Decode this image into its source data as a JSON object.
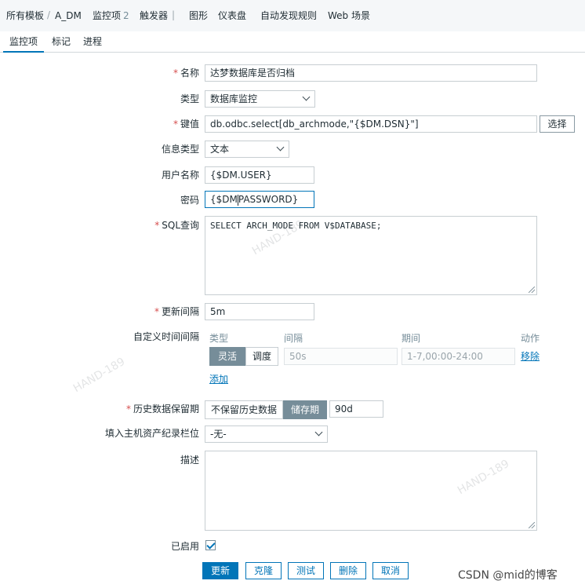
{
  "breadcrumb": {
    "all_templates": "所有模板",
    "separator": "/",
    "host": "A_DM",
    "items_label": "监控项",
    "items_count": "2",
    "triggers": "触发器",
    "triggers_sep": "|",
    "graphs": "图形",
    "dashboards": "仪表盘",
    "discovery": "自动发现规则",
    "web": "Web 场景"
  },
  "tabs": [
    "监控项",
    "标记",
    "进程"
  ],
  "form": {
    "name_label": "名称",
    "name_value": "达梦数据库是否归档",
    "type_label": "类型",
    "type_value": "数据库监控",
    "key_label": "键值",
    "key_value": "db.odbc.select[db_archmode,\"{$DM.DSN}\"]",
    "select_button": "选择",
    "info_type_label": "信息类型",
    "info_type_value": "文本",
    "username_label": "用户名称",
    "username_value": "{$DM.USER}",
    "password_label": "密码",
    "password_value_a": "{$DM",
    "password_value_b": "PASSWORD}",
    "sql_label": "SQL查询",
    "sql_value": "SELECT ARCH_MODE FROM V$DATABASE;",
    "interval_label": "更新间隔",
    "interval_value": "5m",
    "custom_label": "自定义时间间隔",
    "custom_headers": {
      "type": "类型",
      "interval": "间隔",
      "period": "期间",
      "action": "动作"
    },
    "custom_row": {
      "flexible": "灵活",
      "scheduling": "调度",
      "interval": "50s",
      "period": "1-7,00:00-24:00",
      "remove": "移除"
    },
    "add_link": "添加",
    "history_label": "历史数据保留期",
    "history_no_keep": "不保留历史数据",
    "history_storage": "储存期",
    "history_value": "90d",
    "inventory_label": "填入主机资产纪录栏位",
    "inventory_value": "-无-",
    "description_label": "描述",
    "enabled_label": "已启用",
    "required_mark": "*"
  },
  "buttons": {
    "update": "更新",
    "clone": "克隆",
    "test": "测试",
    "delete": "删除",
    "cancel": "取消"
  },
  "watermarks": {
    "small": "HAND-189",
    "csdn": "CSDN @mid的博客"
  },
  "colors": {
    "accent": "#0275b8",
    "segment_on": "#768d99",
    "required": "#d64e4e"
  }
}
